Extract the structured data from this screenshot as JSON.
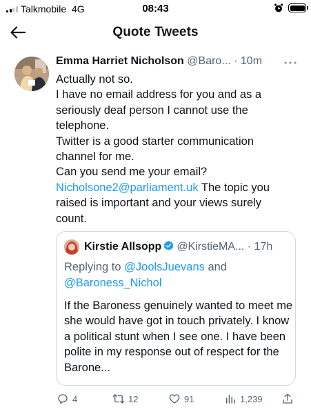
{
  "status_bar": {
    "carrier": "Talkmobile",
    "network": "4G",
    "time": "08:43"
  },
  "header": {
    "title": "Quote Tweets"
  },
  "tweet": {
    "author_name": "Emma Harriet Nicholson",
    "author_handle": "@Baro...",
    "separator": "·",
    "time": "10m",
    "lines": [
      "Actually not so.",
      "I have no email address for you and as a seriously deaf person I cannot use the telephone.",
      "Twitter is a good starter communication channel for me.",
      "Can you send me your email?"
    ],
    "email_link": "Nicholsone2@parliament.uk",
    "after_link": " The topic you raised is important and your views surely count."
  },
  "quoted_tweet": {
    "author_name": "Kirstie Allsopp",
    "author_handle": "@KirstieMA...",
    "separator": "·",
    "time": "17h",
    "replying_to_label": "Replying to ",
    "mention_1": "@JoolsJuevans",
    "and_label": " and",
    "mention_2": "@Baroness_Nichol",
    "text": "If the Baroness genuinely wanted to meet me she would have got in touch privately. I know a political stunt when I see one. I have been polite in my response out of respect for the Barone..."
  },
  "actions": {
    "replies": "4",
    "retweets": "12",
    "likes": "91",
    "views": "1,239"
  },
  "colors": {
    "link": "#1d9bf0",
    "secondary_text": "#536471",
    "border": "#cfd9de",
    "verified": "#1d9bf0"
  },
  "icons": [
    "signal-icon",
    "alarm-icon",
    "battery-icon",
    "back-arrow-icon",
    "more-icon",
    "verified-icon",
    "reply-icon",
    "retweet-icon",
    "like-icon",
    "views-icon",
    "share-icon"
  ]
}
